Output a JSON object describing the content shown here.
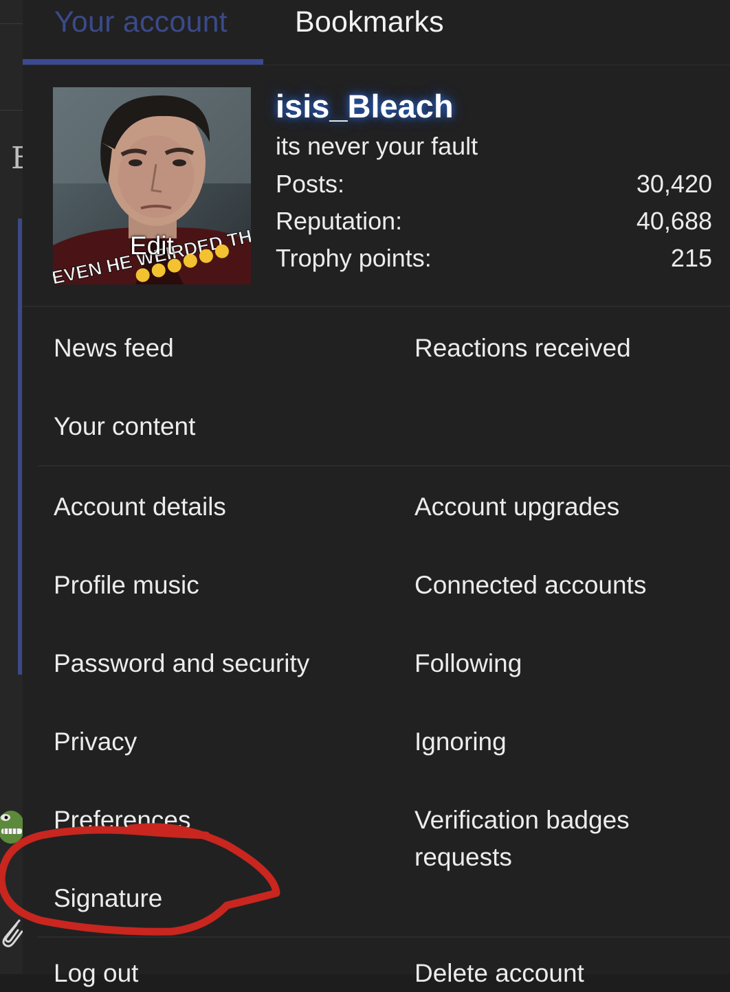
{
  "tabs": [
    {
      "label": "Your account",
      "active": true
    },
    {
      "label": "Bookmarks",
      "active": false
    }
  ],
  "profile": {
    "username": "isis_Bleach",
    "status": "its never your fault",
    "avatar_edit_label": "Edit",
    "avatar_caption": "EVEN HE WEIRDED TH",
    "stats": [
      {
        "label": "Posts:",
        "value": "30,420"
      },
      {
        "label": "Reputation:",
        "value": "40,688"
      },
      {
        "label": "Trophy points:",
        "value": "215"
      }
    ]
  },
  "section1": {
    "news_feed": "News feed",
    "reactions_received": "Reactions received",
    "your_content": "Your content"
  },
  "section2": {
    "account_details": "Account details",
    "account_upgrades": "Account upgrades",
    "profile_music": "Profile music",
    "connected_accounts": "Connected accounts",
    "password_security": "Password and security",
    "following": "Following",
    "privacy": "Privacy",
    "ignoring": "Ignoring",
    "preferences": "Preferences",
    "verification_line1": "Verification badges",
    "verification_line2": "requests",
    "signature": "Signature"
  },
  "section3": {
    "log_out": "Log out",
    "delete_account": "Delete account"
  },
  "colors": {
    "panel_bg": "#212122",
    "accent": "#3b4a92",
    "annotation": "#c8261f",
    "username_glow": "#2d5fb8"
  },
  "icons": [
    "frog-emoji-icon",
    "paperclip-icon"
  ]
}
